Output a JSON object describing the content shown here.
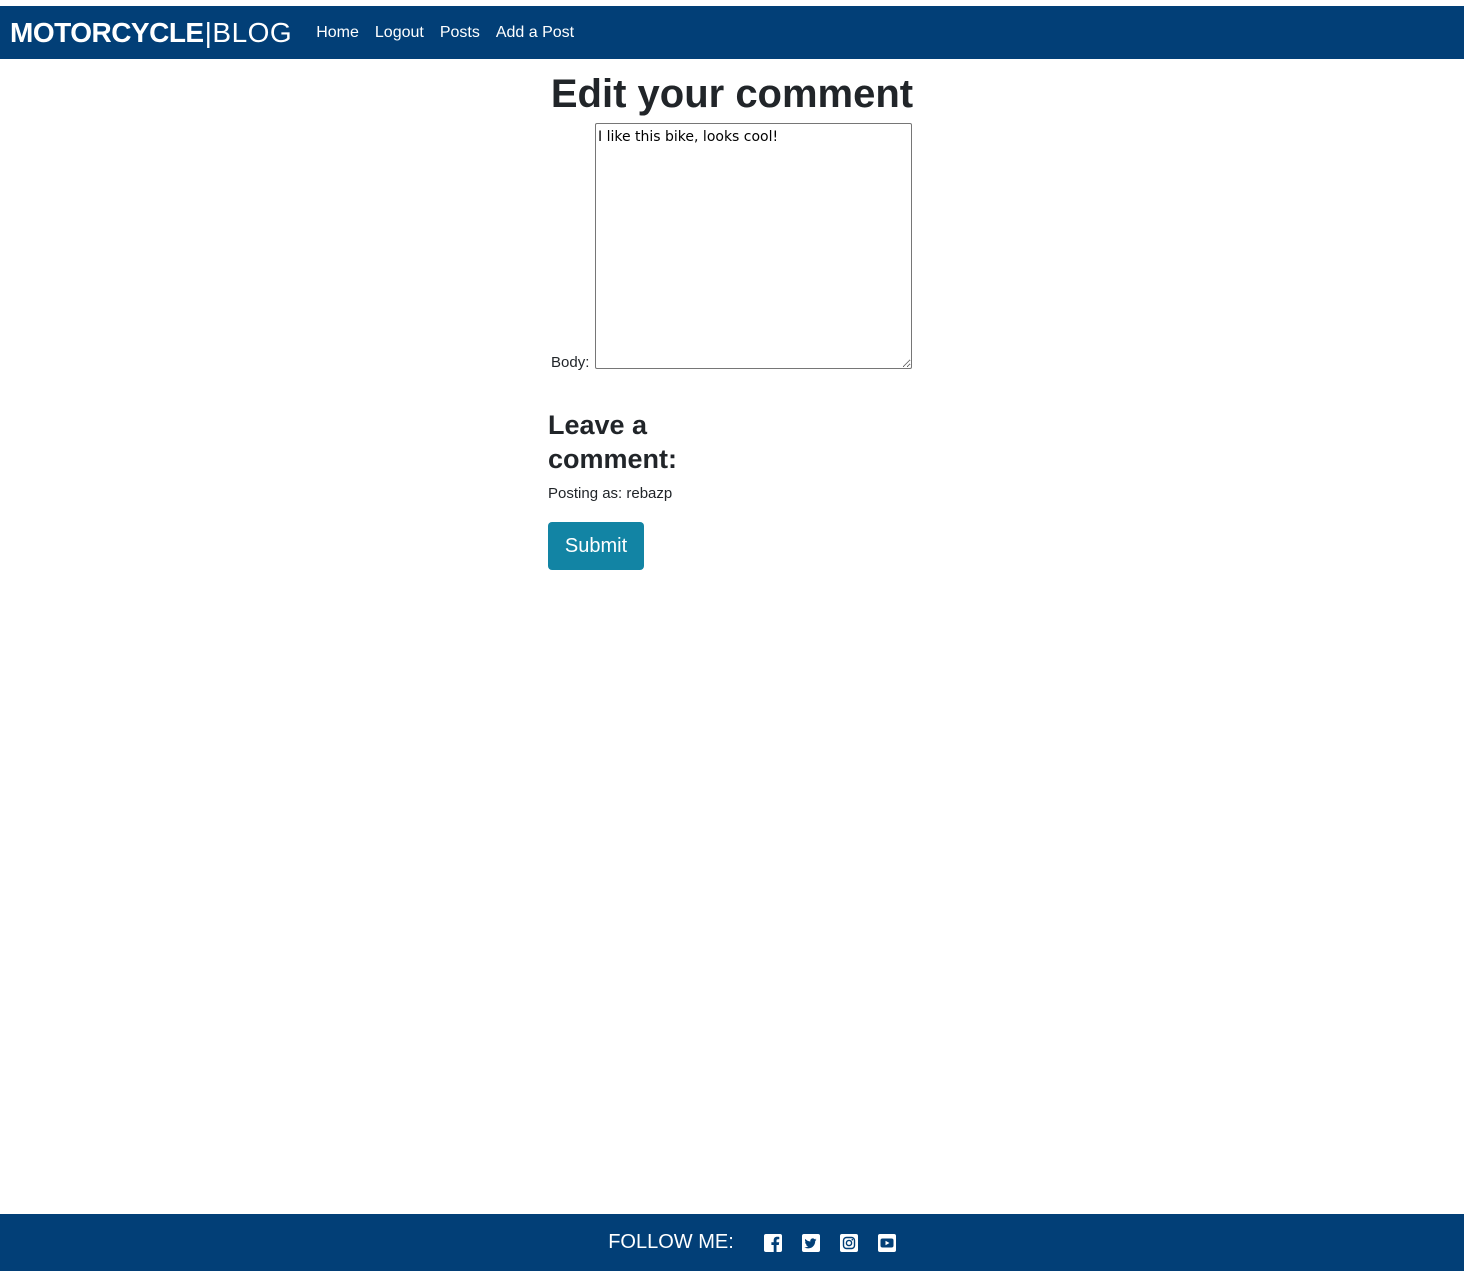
{
  "nav": {
    "brand_bold": "MOTORCYCLE",
    "brand_sep": "|",
    "brand_light": "BLOG",
    "links": [
      {
        "label": "Home"
      },
      {
        "label": "Logout"
      },
      {
        "label": "Posts"
      },
      {
        "label": "Add a Post"
      }
    ]
  },
  "main": {
    "title": "Edit your comment",
    "body_label": "Body:",
    "body_value": "I like this bike, looks cool!",
    "leave_heading": "Leave a comment:",
    "posting_as": "Posting as: rebazp",
    "submit_label": "Submit"
  },
  "footer": {
    "follow_label": "FOLLOW ME:",
    "social_icons": [
      "facebook-icon",
      "twitter-icon",
      "instagram-icon",
      "youtube-icon"
    ]
  },
  "colors": {
    "navbar": "#023f77",
    "button": "#1284a4",
    "text": "#212529"
  }
}
